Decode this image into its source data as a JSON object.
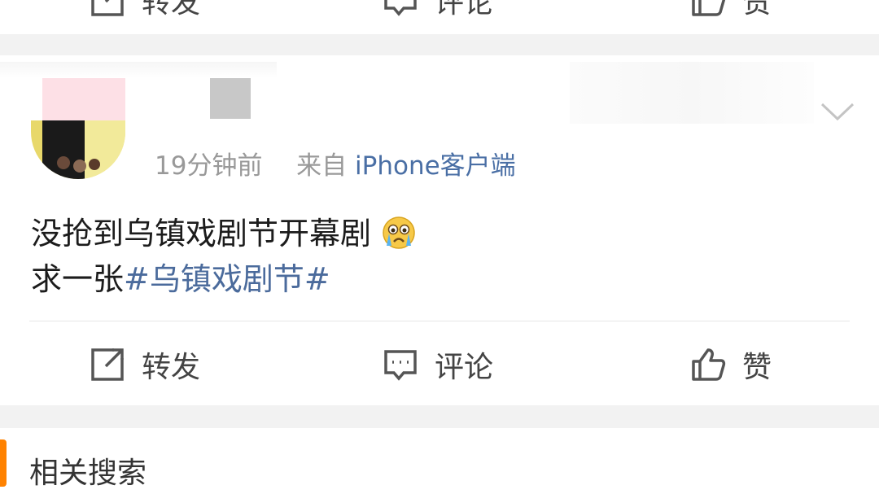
{
  "top_action_bar": {
    "repost_label": "转发",
    "comment_label": "评论",
    "like_label": "赞"
  },
  "post": {
    "time": "19分钟前",
    "from_prefix": "来自",
    "client": "iPhone客户端",
    "line1": "没抢到乌镇戏剧节开幕剧",
    "line2_prefix": "求一张",
    "hashtag": "#乌镇戏剧节#",
    "emoji": "crying-face-emoji",
    "actions": {
      "repost_label": "转发",
      "comment_label": "评论",
      "like_label": "赞"
    }
  },
  "related": {
    "title": "相关搜索"
  },
  "colors": {
    "background": "#f2f2f2",
    "card": "#ffffff",
    "hashtag": "#4b6b9c",
    "client_link": "#4a6fa5",
    "accent": "#ff8200"
  }
}
